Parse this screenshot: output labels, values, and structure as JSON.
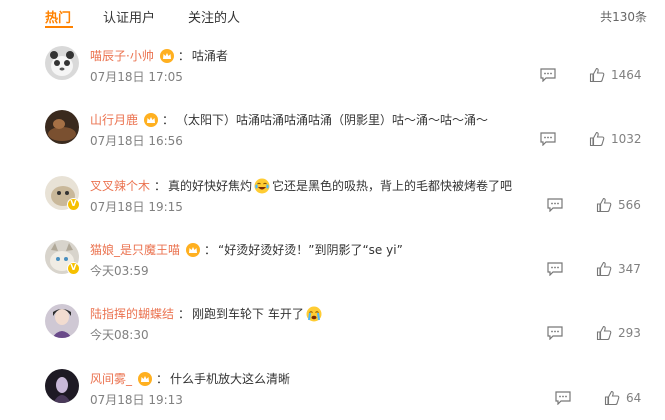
{
  "tabs": {
    "hot": "热门",
    "verified": "认证用户",
    "following": "关注的人",
    "total": "共130条"
  },
  "comments": [
    {
      "username": "喵辰子·小帅",
      "crown": true,
      "verified": false,
      "text": "咕涌者",
      "time": "07月18日 17:05",
      "likes": "1464"
    },
    {
      "username": "山行月鹿",
      "crown": true,
      "verified": false,
      "text": "（太阳下）咕涌咕涌咕涌咕涌（阴影里）咕～涌～咕～涌～",
      "time": "07月18日 16:56",
      "likes": "1032"
    },
    {
      "username": "叉叉辣个木",
      "crown": false,
      "verified": true,
      "text_before": "真的好快好焦灼",
      "text_after": "它还是黑色的吸热，背上的毛都快被烤卷了吧",
      "emoji": "laugh-cry-emoji",
      "time": "07月18日 19:15",
      "likes": "566"
    },
    {
      "username": "猫娘_是只魔王喵",
      "crown": true,
      "verified": true,
      "text": "“好烫好烫好烫！”到阴影了“se yi”",
      "time": "今天03:59",
      "likes": "347"
    },
    {
      "username": "陆指挥的蝴蝶结",
      "crown": false,
      "verified": false,
      "text_before": "刚跑到车轮下 车开了",
      "emoji": "crying-emoji",
      "time": "今天08:30",
      "likes": "293"
    },
    {
      "username": "风间雾_",
      "crown": true,
      "verified": false,
      "text": "什么手机放大这么清晰",
      "time": "07月18日 19:13",
      "likes": "64"
    }
  ],
  "colors": {
    "accent": "#ff8200",
    "username": "#eb7350",
    "meta": "#808080"
  },
  "icons": {
    "reply": "comment-icon",
    "like": "thumbs-up-icon",
    "crown": "crown-badge-icon",
    "verified": "verified-v-badge"
  },
  "badge_letter": "V"
}
